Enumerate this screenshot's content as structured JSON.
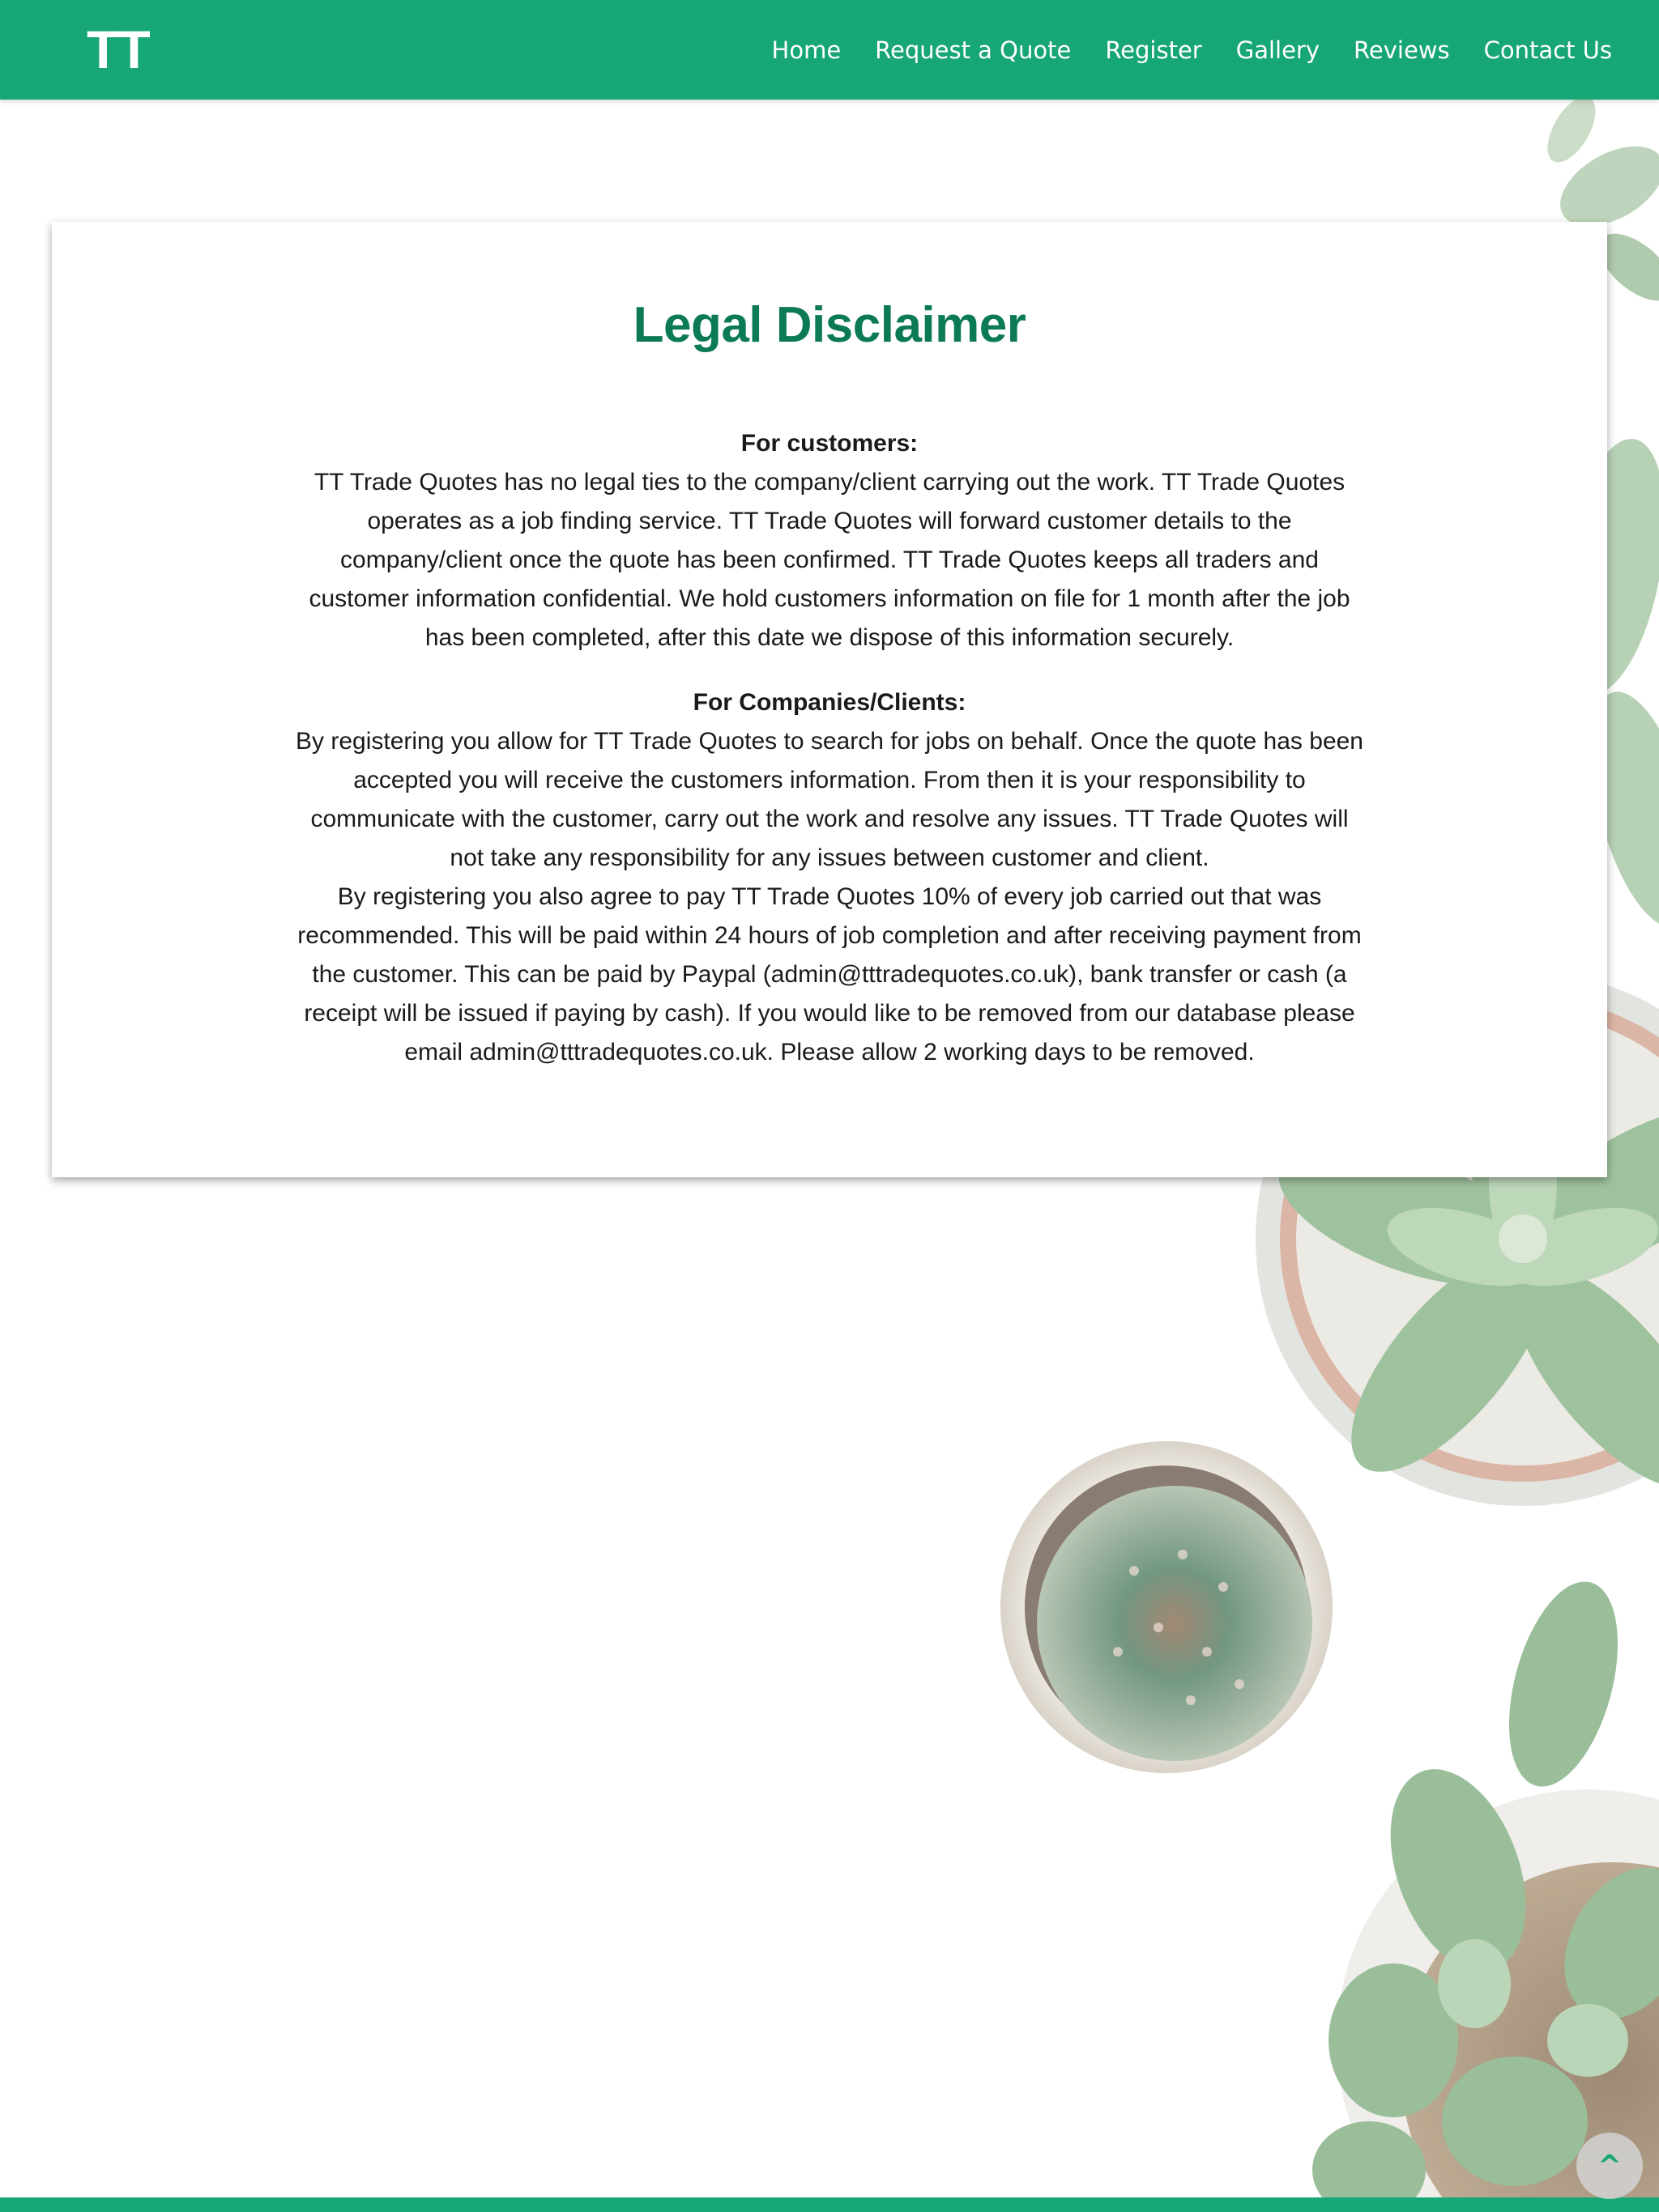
{
  "header": {
    "logo_text": "TT",
    "nav": [
      "Home",
      "Request a Quote",
      "Register",
      "Gallery",
      "Reviews",
      "Contact Us"
    ]
  },
  "page": {
    "title": "Legal Disclaimer",
    "customers_heading": "For customers:",
    "customers_text": "TT Trade Quotes has no legal ties to the company/client carrying out the work. TT Trade Quotes operates as a job finding service. TT Trade Quotes will forward customer details to the company/client once the quote has been confirmed. TT Trade Quotes keeps all traders and customer information confidential. We hold customers information on file for 1 month after the job has been completed, after this date we dispose of this information securely.",
    "companies_heading": "For Companies/Clients:",
    "companies_text_1": "By registering you allow for TT Trade Quotes to search for jobs on behalf. Once the quote has been accepted you will receive the customers information. From then it is your responsibility to communicate with the customer, carry out the work and resolve any issues. TT Trade Quotes will not take any responsibility for any issues between customer and client.",
    "companies_text_2": "By registering you also agree to pay TT Trade Quotes 10% of every job carried out that was recommended. This will be paid within 24 hours of job completion and after receiving payment from the customer. This can be paid by Paypal (admin@tttradequotes.co.uk), bank transfer or cash (a receipt will be issued if paying by cash). If you would like to be removed from our database please email admin@tttradequotes.co.uk. Please allow 2 working days to be removed."
  },
  "back_to_top": {
    "label": "^",
    "icon": "caret-up-icon"
  },
  "colors": {
    "brand_green": "#17a675",
    "title_green": "#0c7a55"
  }
}
